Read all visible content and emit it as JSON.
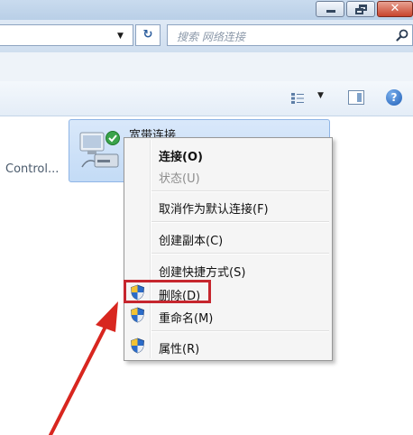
{
  "search": {
    "placeholder": "搜索 网络连接"
  },
  "toolbar": {
    "help_label": "?"
  },
  "left_panel": {
    "control_text": "Control..."
  },
  "network_item": {
    "title": "宽带连接"
  },
  "context_menu": {
    "items": [
      {
        "label": "连接(O)"
      },
      {
        "label": "状态(U)"
      },
      {
        "label": "取消作为默认连接(F)"
      },
      {
        "label": "创建副本(C)"
      },
      {
        "label": "创建快捷方式(S)"
      },
      {
        "label": "删除(D)"
      },
      {
        "label": "重命名(M)"
      },
      {
        "label": "属性(R)"
      }
    ]
  },
  "colors": {
    "highlight_box": "#c6262e",
    "annotation_arrow": "#d8261f",
    "shield_blue": "#2a6bc9",
    "shield_yellow": "#f3c232"
  },
  "icons": {
    "minimize": "minimize-icon",
    "maximize": "restore-icon",
    "close": "close-icon",
    "refresh": "refresh-icon",
    "search": "search-icon",
    "views": "views-icon",
    "preview_pane": "preview-pane-icon",
    "help": "help-icon",
    "connection": "broadband-connection-icon",
    "shield": "uac-shield-icon"
  }
}
